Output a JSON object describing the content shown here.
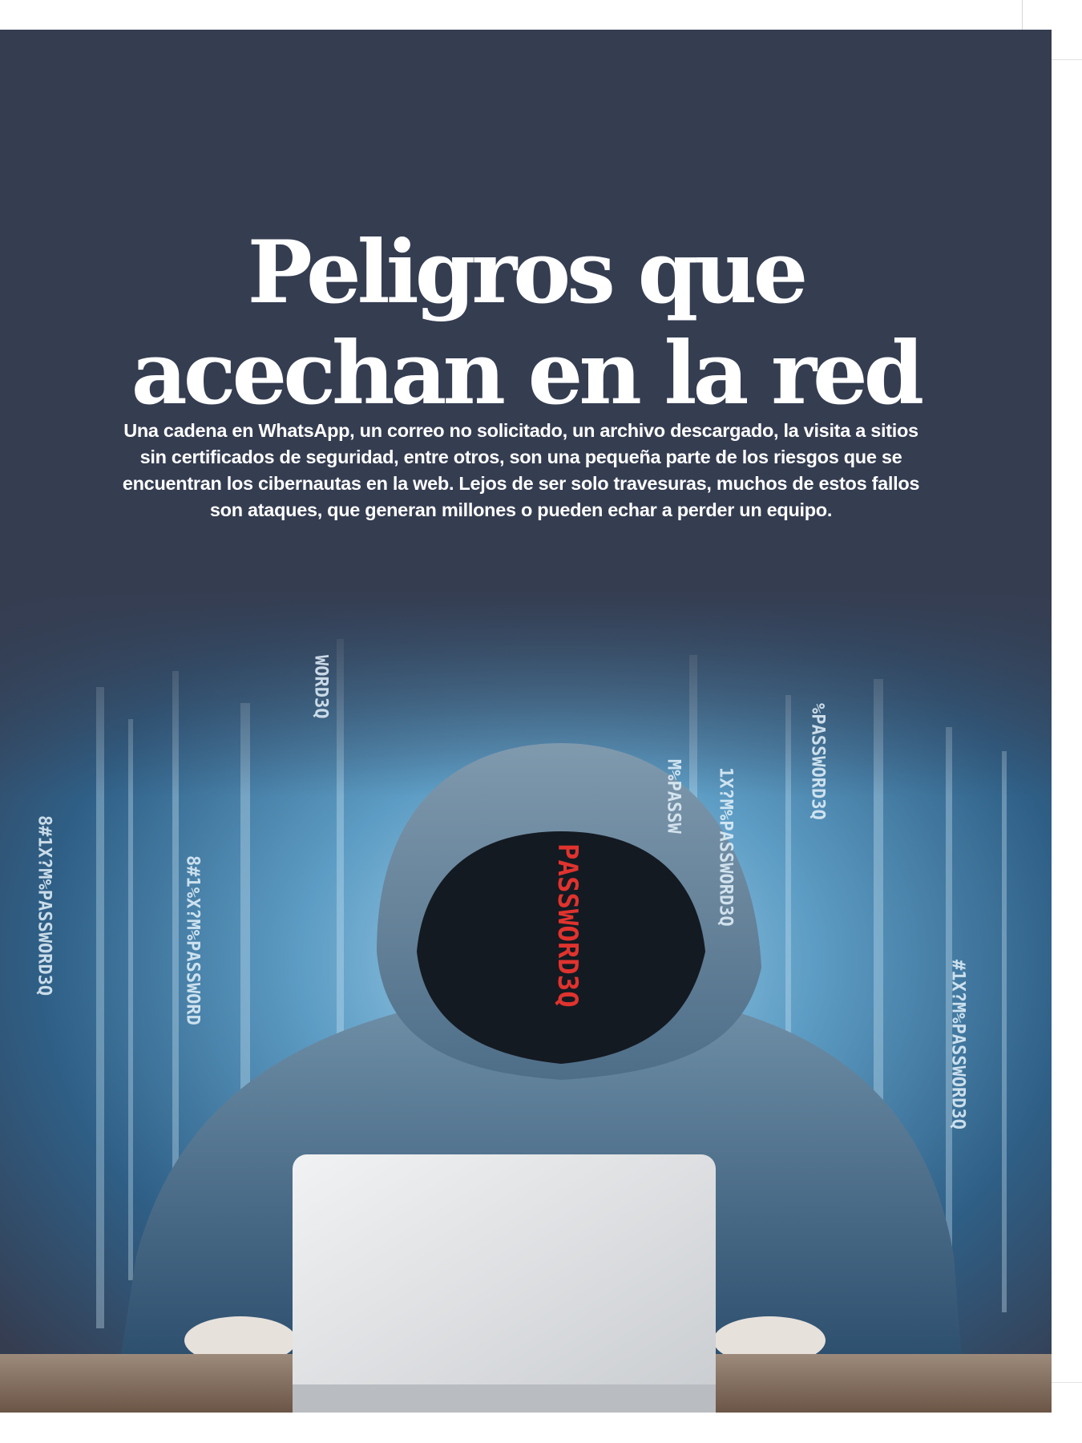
{
  "article": {
    "title_line1": "Peligros que",
    "title_line2": "acechan en la red",
    "lede": "Una cadena en WhatsApp, un correo no solicitado, un archivo descargado, la visita a sitios sin certificados de seguridad, entre otros, son una pequeña parte de los riesgos que se encuentran los cibernautas en la web. Lejos de ser solo travesuras, muchos de estos fallos son ataques, que generan millones o pueden echar a perder un equipo."
  },
  "photo": {
    "subject": "hooded-hacker-with-laptop",
    "code_columns": [
      "8#1X?M%PASSWORD3Q",
      "8#1%X?M%PASSWORD",
      "WORD3Q",
      "1X?M%PASSWORD3Q",
      "%PASSWORD3Q",
      "M%PASSW",
      "#1X?M%PASSWORD3Q"
    ],
    "red_code": "PASSWORD3Q"
  },
  "colors": {
    "panel": "#353d51",
    "title": "#ffffff",
    "photo_glow": "#8fc6e6",
    "red_code": "#e0332e"
  }
}
